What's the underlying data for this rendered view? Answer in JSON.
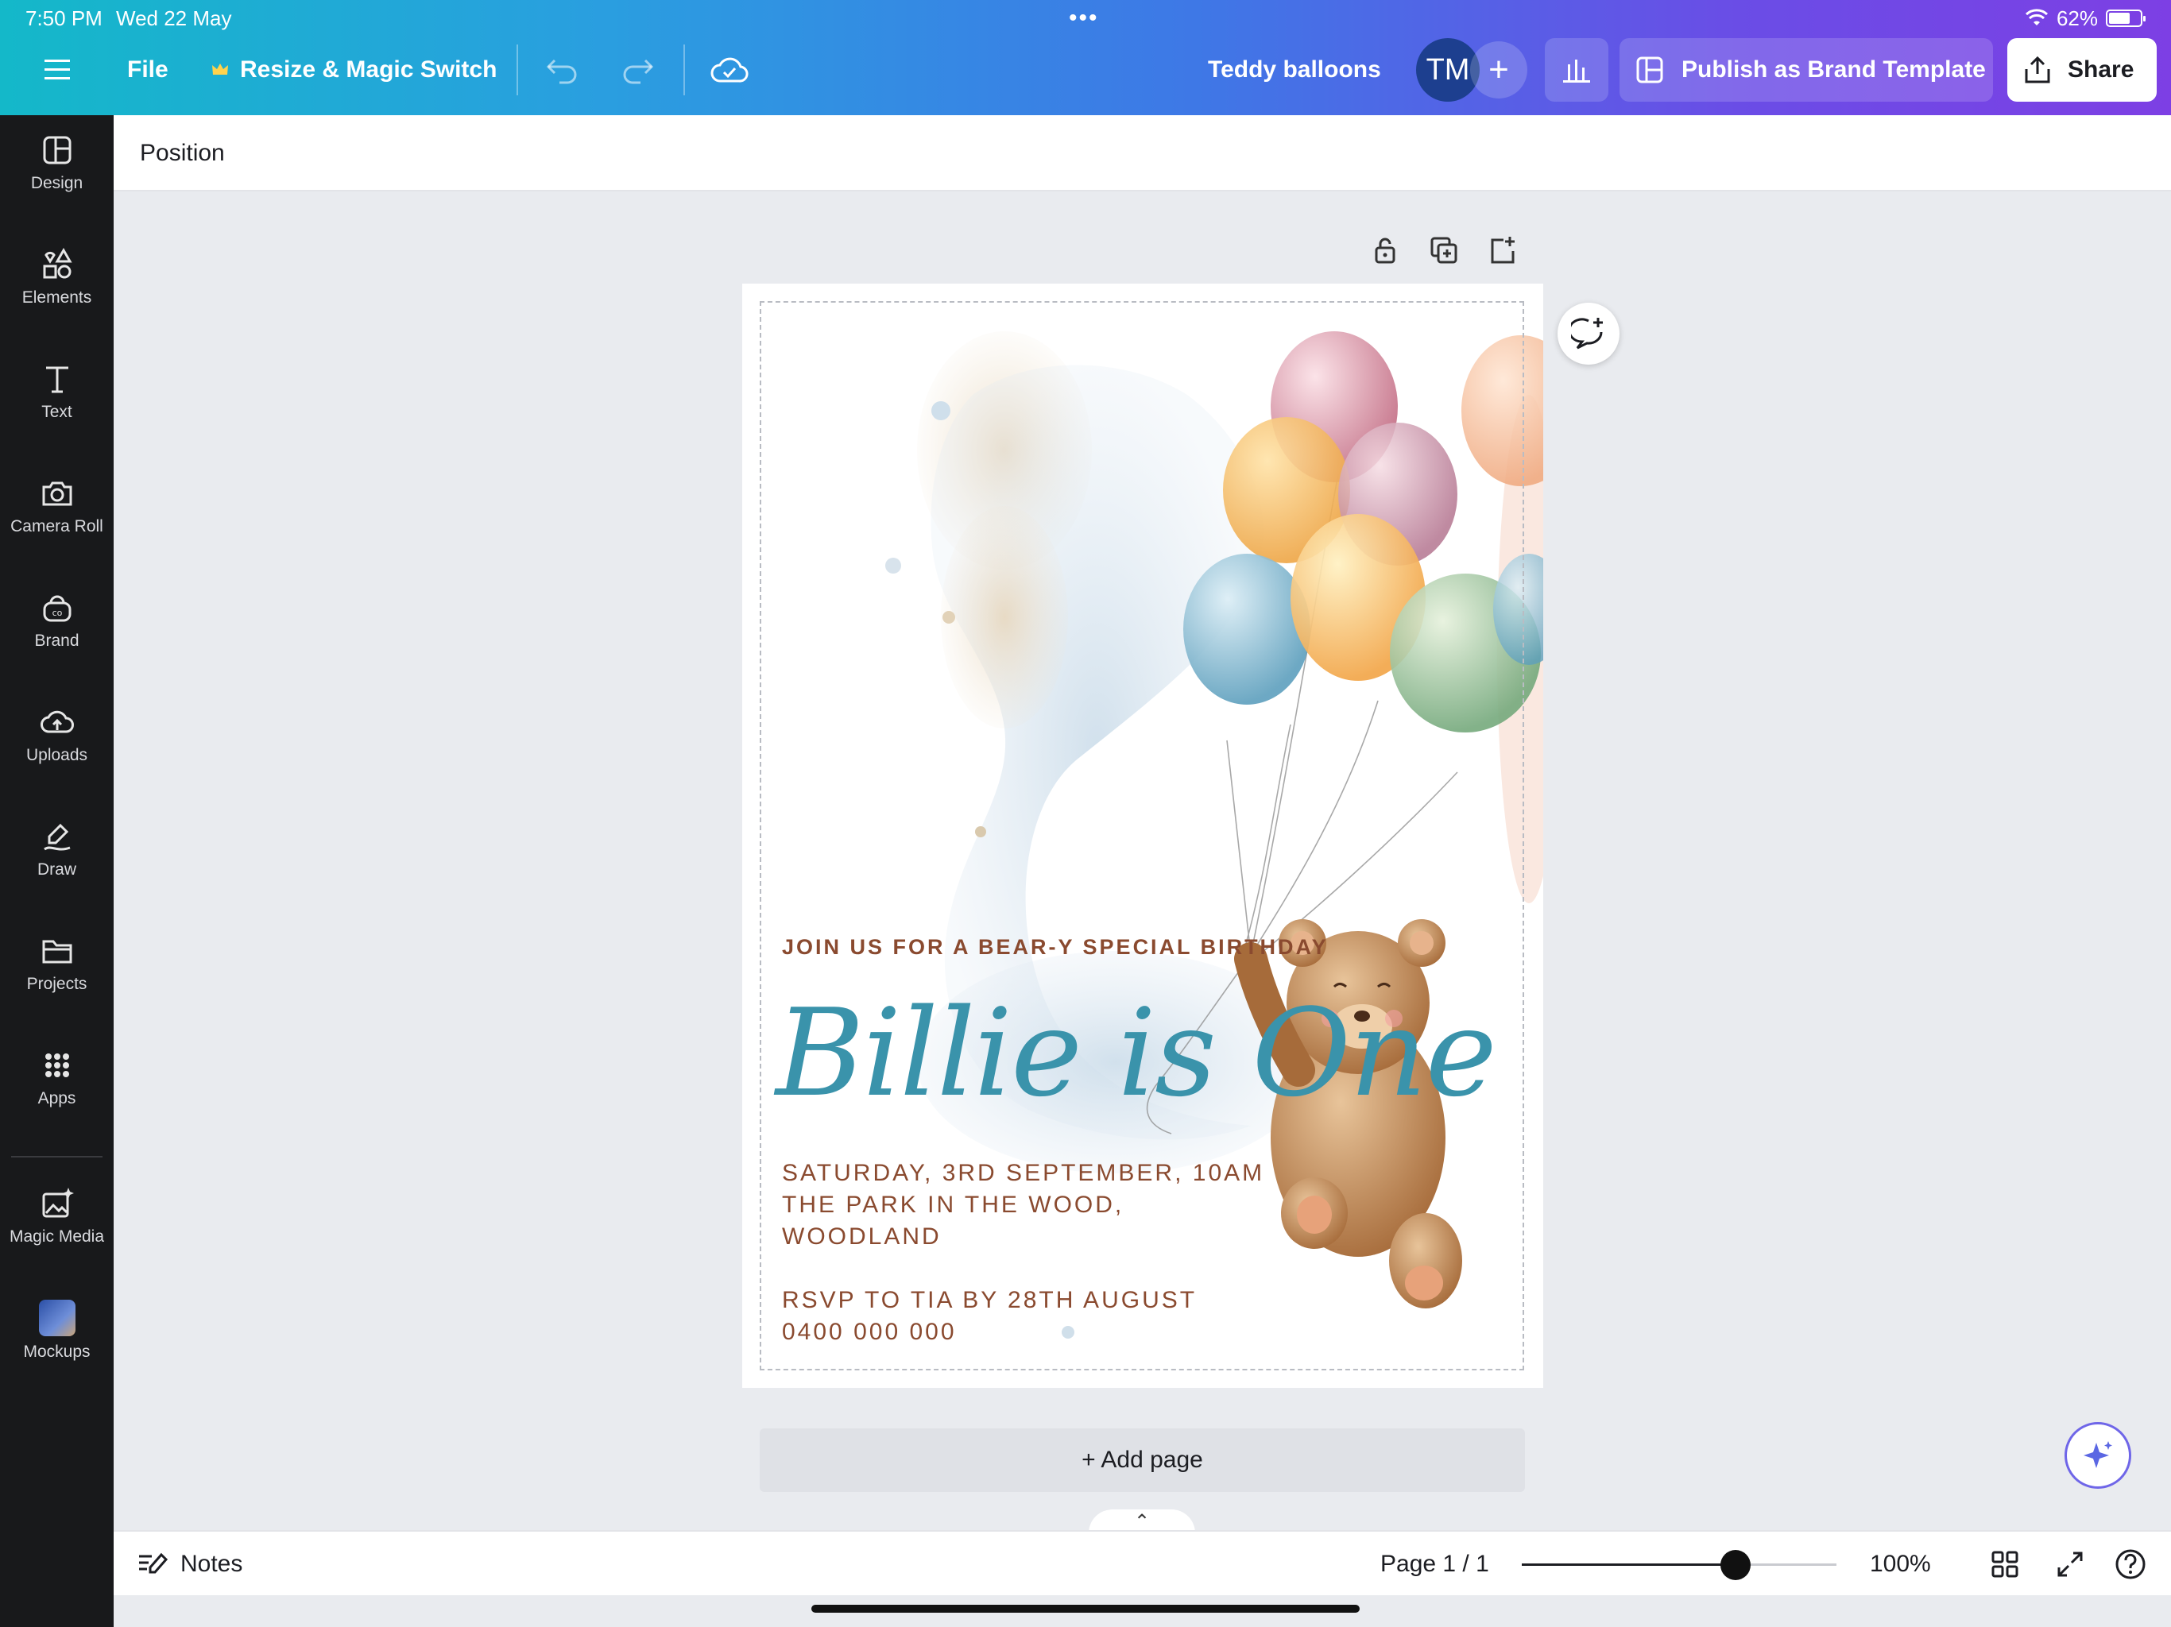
{
  "status_bar": {
    "time": "7:50 PM",
    "date": "Wed 22 May",
    "battery": "62%"
  },
  "toolbar": {
    "file_label": "File",
    "resize_label": "Resize & Magic Switch",
    "design_title": "Teddy balloons",
    "avatar_initials": "TM",
    "publish_label": "Publish as Brand Template",
    "share_label": "Share"
  },
  "sidebar": {
    "items": [
      {
        "label": "Design",
        "icon": "design-icon"
      },
      {
        "label": "Elements",
        "icon": "elements-icon"
      },
      {
        "label": "Text",
        "icon": "text-icon"
      },
      {
        "label": "Camera Roll",
        "icon": "camera-icon"
      },
      {
        "label": "Brand",
        "icon": "brand-icon"
      },
      {
        "label": "Uploads",
        "icon": "upload-cloud-icon"
      },
      {
        "label": "Draw",
        "icon": "draw-icon"
      },
      {
        "label": "Projects",
        "icon": "folder-icon"
      },
      {
        "label": "Apps",
        "icon": "apps-grid-icon"
      },
      {
        "label": "Magic Media",
        "icon": "magic-media-icon"
      },
      {
        "label": "Mockups",
        "icon": "mockups-icon"
      }
    ]
  },
  "context_bar": {
    "position_label": "Position"
  },
  "invitation": {
    "join_line": "JOIN US FOR A BEAR-Y SPECIAL BIRTHDAY",
    "title": "Billie is One",
    "details_line1": "SATURDAY, 3RD SEPTEMBER, 10AM",
    "details_line2": "THE PARK IN THE WOOD,",
    "details_line3": "WOODLAND",
    "rsvp_line1": "RSVP TO TIA BY 28TH AUGUST",
    "rsvp_line2": "0400 000 000"
  },
  "canvas": {
    "add_page_label": "+ Add page"
  },
  "bottom_bar": {
    "notes_label": "Notes",
    "page_indicator": "Page 1 / 1",
    "zoom_label": "100%",
    "zoom_slider_fraction": 0.68
  },
  "colors": {
    "title_blue": "#3a93ab",
    "text_brown": "#8a4a2f",
    "sidebar_bg": "#18191b"
  }
}
